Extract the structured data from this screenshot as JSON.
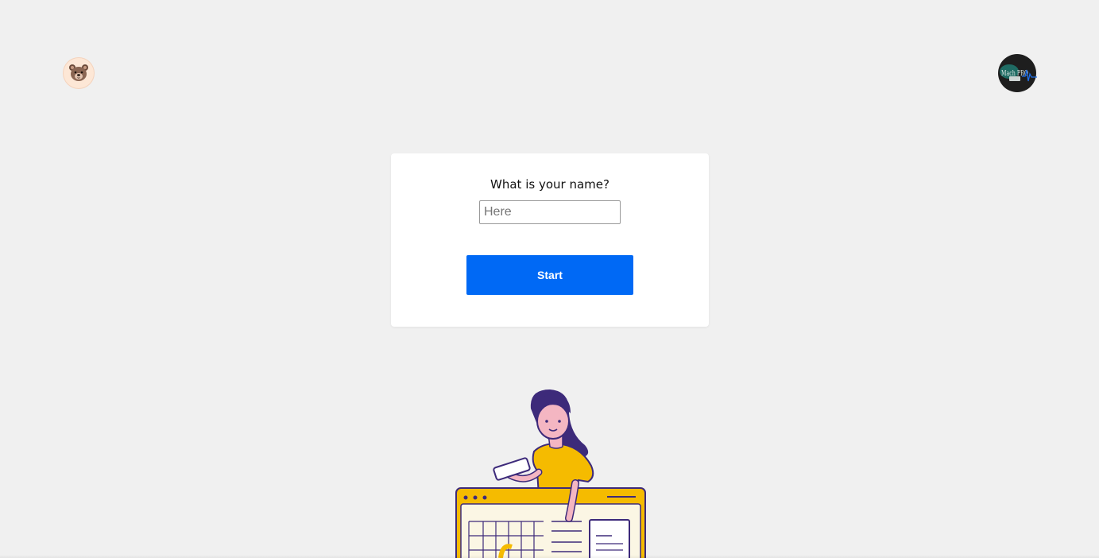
{
  "header": {
    "left_avatar_icon": "bear-face-icon",
    "right_logo_icon": "brand-logo-icon",
    "right_logo_text": "Mach PRO"
  },
  "form": {
    "question": "What is your name?",
    "name_placeholder": "Here",
    "name_value": "",
    "start_label": "Start"
  },
  "illustration": {
    "icon": "woman-with-phone-at-dashboard-illustration"
  },
  "colors": {
    "background": "#f0f0f0",
    "card": "#ffffff",
    "accent": "#0069f5",
    "illustration_yellow": "#f5bb00",
    "illustration_purple": "#3d2a7a"
  }
}
